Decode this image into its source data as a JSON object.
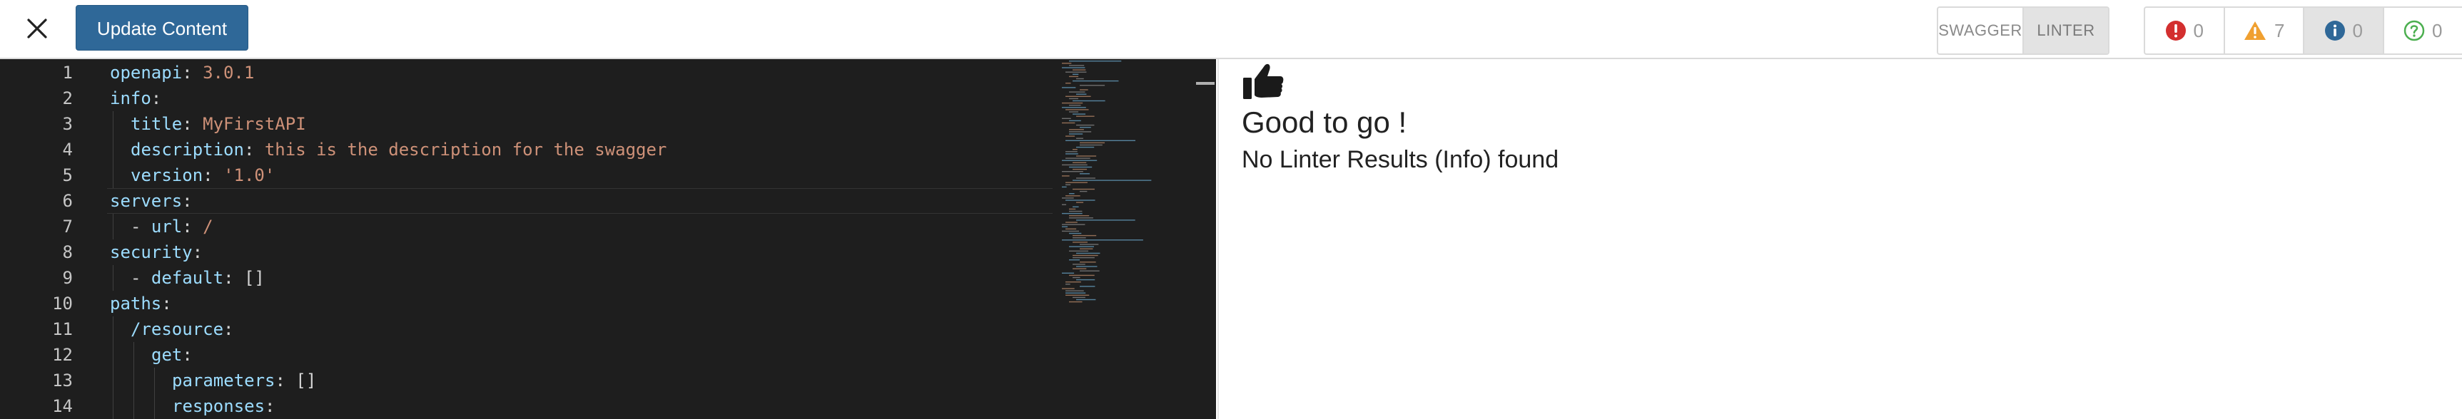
{
  "toolbar": {
    "update_label": "Update Content",
    "view_tabs": [
      {
        "label": "SWAGGER",
        "active": false
      },
      {
        "label": "LINTER",
        "active": true
      }
    ],
    "counts": [
      {
        "kind": "error",
        "value": "0",
        "color": "#d32f2f",
        "icon": "error-icon"
      },
      {
        "kind": "warning",
        "value": "7",
        "color": "#f0a030",
        "icon": "warning-icon"
      },
      {
        "kind": "info",
        "value": "0",
        "color": "#2f6898",
        "icon": "info-icon",
        "active": true
      },
      {
        "kind": "hint",
        "value": "0",
        "color": "#4caf50",
        "icon": "help-icon"
      }
    ]
  },
  "editor": {
    "lines": [
      {
        "n": "1",
        "indent": 0,
        "tokens": [
          [
            "k",
            "openapi"
          ],
          [
            "p",
            ": "
          ],
          [
            "s",
            "3.0.1"
          ]
        ]
      },
      {
        "n": "2",
        "indent": 0,
        "tokens": [
          [
            "k",
            "info"
          ],
          [
            "p",
            ":"
          ]
        ]
      },
      {
        "n": "3",
        "indent": 1,
        "tokens": [
          [
            "k",
            "title"
          ],
          [
            "p",
            ": "
          ],
          [
            "s",
            "MyFirstAPI"
          ]
        ]
      },
      {
        "n": "4",
        "indent": 1,
        "tokens": [
          [
            "k",
            "description"
          ],
          [
            "p",
            ": "
          ],
          [
            "s",
            "this is the description for the swagger"
          ]
        ]
      },
      {
        "n": "5",
        "indent": 1,
        "tokens": [
          [
            "k",
            "version"
          ],
          [
            "p",
            ": "
          ],
          [
            "s",
            "'1.0'"
          ]
        ]
      },
      {
        "n": "6",
        "indent": 0,
        "tokens": [
          [
            "k",
            "servers"
          ],
          [
            "p",
            ":"
          ]
        ]
      },
      {
        "n": "7",
        "indent": 1,
        "tokens": [
          [
            "p",
            "- "
          ],
          [
            "k",
            "url"
          ],
          [
            "p",
            ": "
          ],
          [
            "s",
            "/"
          ]
        ]
      },
      {
        "n": "8",
        "indent": 0,
        "tokens": [
          [
            "k",
            "security"
          ],
          [
            "p",
            ":"
          ]
        ]
      },
      {
        "n": "9",
        "indent": 1,
        "tokens": [
          [
            "p",
            "- "
          ],
          [
            "k",
            "default"
          ],
          [
            "p",
            ": "
          ],
          [
            "b",
            "[]"
          ]
        ]
      },
      {
        "n": "10",
        "indent": 0,
        "tokens": [
          [
            "k",
            "paths"
          ],
          [
            "p",
            ":"
          ]
        ]
      },
      {
        "n": "11",
        "indent": 1,
        "tokens": [
          [
            "k",
            "/resource"
          ],
          [
            "p",
            ":"
          ]
        ]
      },
      {
        "n": "12",
        "indent": 2,
        "tokens": [
          [
            "k",
            "get"
          ],
          [
            "p",
            ":"
          ]
        ]
      },
      {
        "n": "13",
        "indent": 3,
        "tokens": [
          [
            "k",
            "parameters"
          ],
          [
            "p",
            ": "
          ],
          [
            "b",
            "[]"
          ]
        ]
      },
      {
        "n": "14",
        "indent": 3,
        "tokens": [
          [
            "k",
            "responses"
          ],
          [
            "p",
            ":"
          ]
        ]
      }
    ]
  },
  "results": {
    "icon": "thumbs-up-icon",
    "heading": "Good to go !",
    "message": "No Linter Results (Info) found"
  }
}
